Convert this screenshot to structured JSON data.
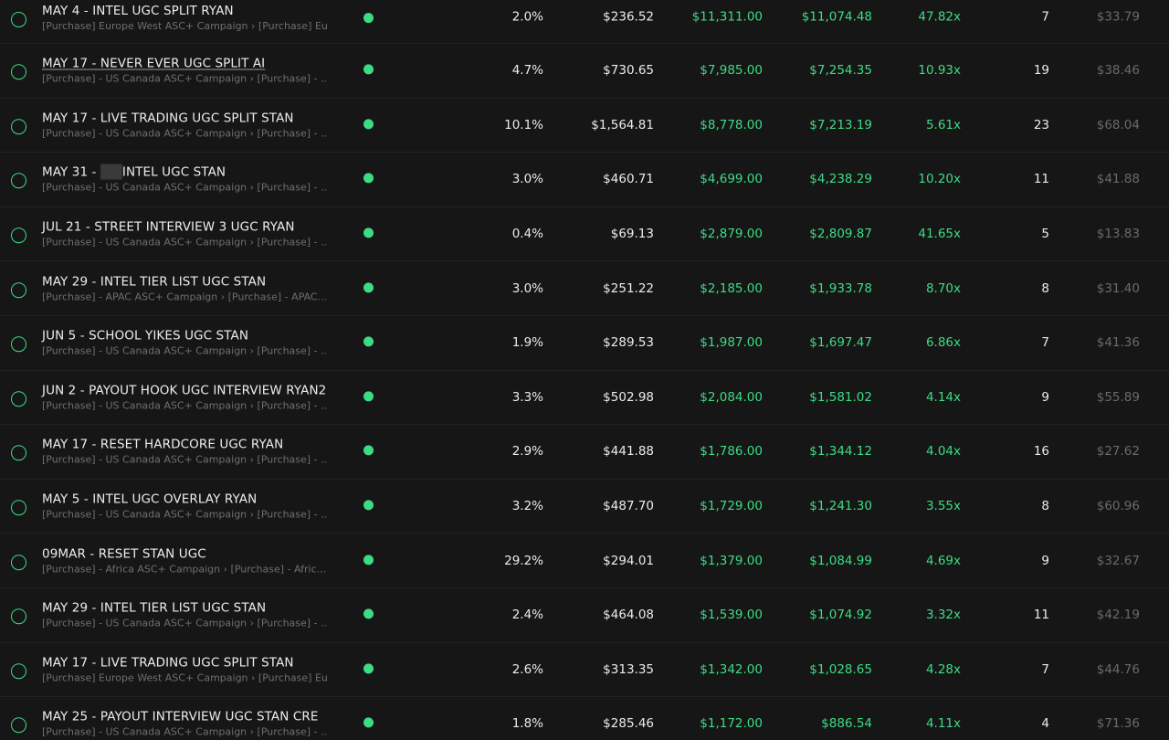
{
  "rows": [
    {
      "name": "MAY 4 - INTEL UGC SPLIT RYAN",
      "campaign": "[Purchase] Europe West ASC+ Campaign › [Purchase] Eu...",
      "ctr": "2.0%",
      "spend": "$236.52",
      "revenue": "$11,311.00",
      "profit": "$11,074.48",
      "roas": "47.82x",
      "purchases": "7",
      "cpa": "$33.79"
    },
    {
      "name": "MAY 17 - NEVER EVER UGC SPLIT AI",
      "campaign": "[Purchase] - US Canada ASC+ Campaign › [Purchase] - ...",
      "ctr": "4.7%",
      "spend": "$730.65",
      "revenue": "$7,985.00",
      "profit": "$7,254.35",
      "roas": "10.93x",
      "purchases": "19",
      "cpa": "$38.46"
    },
    {
      "name": "MAY 17 - LIVE TRADING UGC SPLIT STAN",
      "campaign": "[Purchase] - US Canada ASC+ Campaign › [Purchase] - ...",
      "ctr": "10.1%",
      "spend": "$1,564.81",
      "revenue": "$8,778.00",
      "profit": "$7,213.19",
      "roas": "5.61x",
      "purchases": "23",
      "cpa": "$68.04"
    },
    {
      "name_before": "MAY 31 - ",
      "name_after": "INTEL UGC STAN",
      "campaign": "[Purchase] - US Canada ASC+ Campaign › [Purchase] - ...",
      "ctr": "3.0%",
      "spend": "$460.71",
      "revenue": "$4,699.00",
      "profit": "$4,238.29",
      "roas": "10.20x",
      "purchases": "11",
      "cpa": "$41.88"
    },
    {
      "name": "JUL 21 - STREET INTERVIEW 3 UGC RYAN",
      "campaign": "[Purchase] - US Canada ASC+ Campaign › [Purchase] - ...",
      "ctr": "0.4%",
      "spend": "$69.13",
      "revenue": "$2,879.00",
      "profit": "$2,809.87",
      "roas": "41.65x",
      "purchases": "5",
      "cpa": "$13.83"
    },
    {
      "name": "MAY 29 - INTEL TIER LIST UGC STAN",
      "campaign": "[Purchase] - APAC ASC+ Campaign › [Purchase] - APAC...",
      "ctr": "3.0%",
      "spend": "$251.22",
      "revenue": "$2,185.00",
      "profit": "$1,933.78",
      "roas": "8.70x",
      "purchases": "8",
      "cpa": "$31.40"
    },
    {
      "name": "JUN 5 - SCHOOL YIKES UGC STAN",
      "campaign": "[Purchase] - US Canada ASC+ Campaign › [Purchase] - ...",
      "ctr": "1.9%",
      "spend": "$289.53",
      "revenue": "$1,987.00",
      "profit": "$1,697.47",
      "roas": "6.86x",
      "purchases": "7",
      "cpa": "$41.36"
    },
    {
      "name": "JUN 2 - PAYOUT HOOK UGC INTERVIEW RYAN2",
      "campaign": "[Purchase] - US Canada ASC+ Campaign › [Purchase] - ...",
      "ctr": "3.3%",
      "spend": "$502.98",
      "revenue": "$2,084.00",
      "profit": "$1,581.02",
      "roas": "4.14x",
      "purchases": "9",
      "cpa": "$55.89"
    },
    {
      "name": "MAY 17 - RESET HARDCORE UGC RYAN",
      "campaign": "[Purchase] - US Canada ASC+ Campaign › [Purchase] - ...",
      "ctr": "2.9%",
      "spend": "$441.88",
      "revenue": "$1,786.00",
      "profit": "$1,344.12",
      "roas": "4.04x",
      "purchases": "16",
      "cpa": "$27.62"
    },
    {
      "name": "MAY 5 - INTEL UGC OVERLAY RYAN",
      "campaign": "[Purchase] - US Canada ASC+ Campaign › [Purchase] - ...",
      "ctr": "3.2%",
      "spend": "$487.70",
      "revenue": "$1,729.00",
      "profit": "$1,241.30",
      "roas": "3.55x",
      "purchases": "8",
      "cpa": "$60.96"
    },
    {
      "name": "09MAR - RESET STAN UGC",
      "campaign": "[Purchase] - Africa ASC+ Campaign › [Purchase] - Afric...",
      "ctr": "29.2%",
      "spend": "$294.01",
      "revenue": "$1,379.00",
      "profit": "$1,084.99",
      "roas": "4.69x",
      "purchases": "9",
      "cpa": "$32.67"
    },
    {
      "name": "MAY 29 - INTEL TIER LIST UGC STAN",
      "campaign": "[Purchase] - US Canada ASC+ Campaign › [Purchase] - ...",
      "ctr": "2.4%",
      "spend": "$464.08",
      "revenue": "$1,539.00",
      "profit": "$1,074.92",
      "roas": "3.32x",
      "purchases": "11",
      "cpa": "$42.19"
    },
    {
      "name": "MAY 17 - LIVE TRADING UGC SPLIT STAN",
      "campaign": "[Purchase] Europe West ASC+ Campaign › [Purchase] Eu...",
      "ctr": "2.6%",
      "spend": "$313.35",
      "revenue": "$1,342.00",
      "profit": "$1,028.65",
      "roas": "4.28x",
      "purchases": "7",
      "cpa": "$44.76"
    },
    {
      "name": "MAY 25 - PAYOUT INTERVIEW UGC STAN CRE",
      "campaign": "[Purchase] - US Canada ASC+ Campaign › [Purchase] - ...",
      "ctr": "1.8%",
      "spend": "$285.46",
      "revenue": "$1,172.00",
      "profit": "$886.54",
      "roas": "4.11x",
      "purchases": "4",
      "cpa": "$71.36"
    }
  ],
  "colors": {
    "background": "#161616",
    "positive": "#3ddc84",
    "text": "#ececec",
    "muted": "#6f6f6f"
  }
}
